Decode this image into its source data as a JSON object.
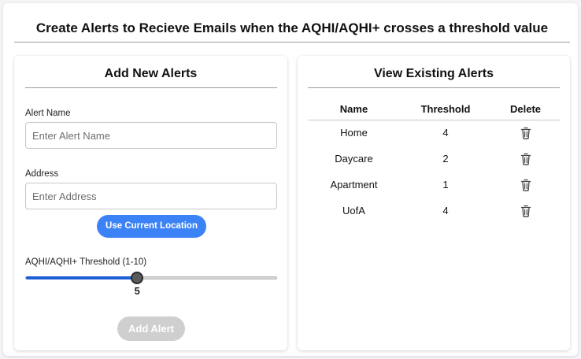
{
  "page": {
    "title": "Create Alerts to Recieve Emails when the AQHI/AQHI+ crosses a threshold value"
  },
  "add_panel": {
    "title": "Add New Alerts",
    "alert_name_label": "Alert Name",
    "alert_name_placeholder": "Enter Alert Name",
    "alert_name_value": "",
    "address_label": "Address",
    "address_placeholder": "Enter Address",
    "address_value": "",
    "use_location_label": "Use Current Location",
    "threshold_label": "AQHI/AQHI+ Threshold (1-10)",
    "threshold": {
      "value": 5,
      "min": 1,
      "max": 10
    },
    "add_button_label": "Add Alert",
    "add_button_enabled": false
  },
  "view_panel": {
    "title": "View Existing Alerts",
    "columns": [
      "Name",
      "Threshold",
      "Delete"
    ],
    "rows": [
      {
        "name": "Home",
        "threshold": "4"
      },
      {
        "name": "Daycare",
        "threshold": "2"
      },
      {
        "name": "Apartment",
        "threshold": "1"
      },
      {
        "name": "UofA",
        "threshold": "4"
      }
    ],
    "delete_icon": "trash-icon"
  },
  "colors": {
    "accent": "#3b82f6",
    "slider_fill": "#1f5fd6",
    "disabled_button": "#cfcfcf"
  }
}
